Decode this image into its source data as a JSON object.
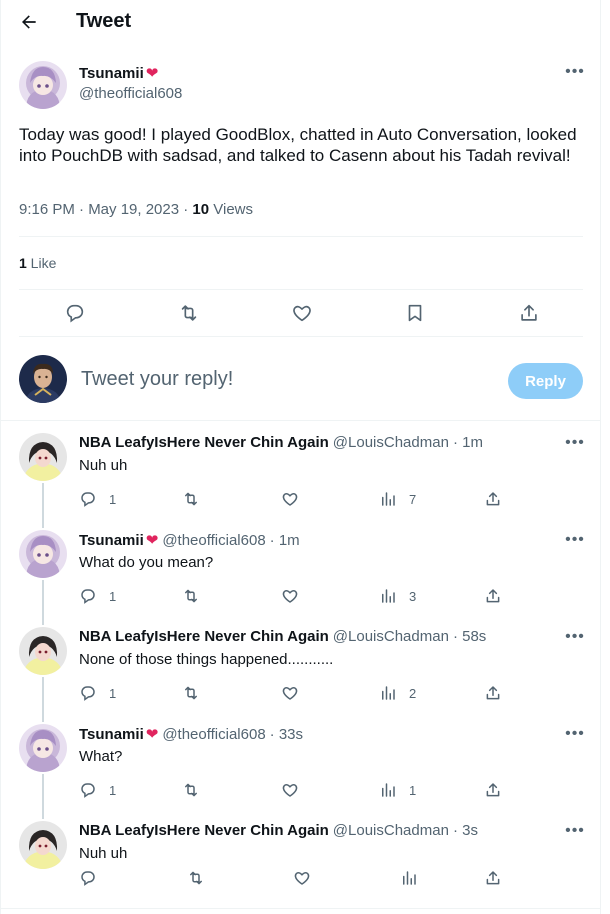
{
  "header": {
    "title": "Tweet"
  },
  "main_tweet": {
    "author_name": "Tsunamii",
    "author_handle": "@theofficial608",
    "text": "Today was good! I played GoodBlox, chatted in Auto Conversation, looked into PouchDB with sadsad, and talked to Casenn about his Tadah revival!",
    "time": "9:16 PM · May 19, 2023 · ",
    "views_count": "10",
    "views_label": " Views",
    "likes_count": "1",
    "likes_label": " Like"
  },
  "composer": {
    "placeholder": "Tweet your reply!",
    "reply_label": "Reply"
  },
  "replies": [
    {
      "name": "NBA LeafyIsHere Never Chin Again",
      "handle": "@LouisChadman",
      "time": "· 1m",
      "text": "Nuh uh",
      "replies": "1",
      "views": "7"
    },
    {
      "name": "Tsunamii",
      "handle": "@theofficial608",
      "time": "· 1m",
      "text": "What do you mean?",
      "replies": "1",
      "views": "3"
    },
    {
      "name": "NBA LeafyIsHere Never Chin Again",
      "handle": "@LouisChadman",
      "time": "· 58s",
      "text": "None of those things happened...........",
      "replies": "1",
      "views": "2"
    },
    {
      "name": "Tsunamii",
      "handle": "@theofficial608",
      "time": "· 33s",
      "text": "What?",
      "replies": "1",
      "views": "1"
    },
    {
      "name": "NBA LeafyIsHere Never Chin Again",
      "handle": "@LouisChadman",
      "time": "· 3s",
      "text": "Nuh uh",
      "replies": "",
      "views": ""
    }
  ],
  "colors": {
    "accent": "#1d9bf0",
    "reply_button_disabled": "#8ecdf8",
    "text_secondary": "#536471",
    "badge_heart": "#e0245e"
  },
  "icons": {
    "back": "arrow-left-icon",
    "more": "more-icon",
    "reply": "reply-icon",
    "retweet": "retweet-icon",
    "like": "heart-icon",
    "bookmark": "bookmark-icon",
    "share": "share-icon",
    "views": "views-icon"
  }
}
